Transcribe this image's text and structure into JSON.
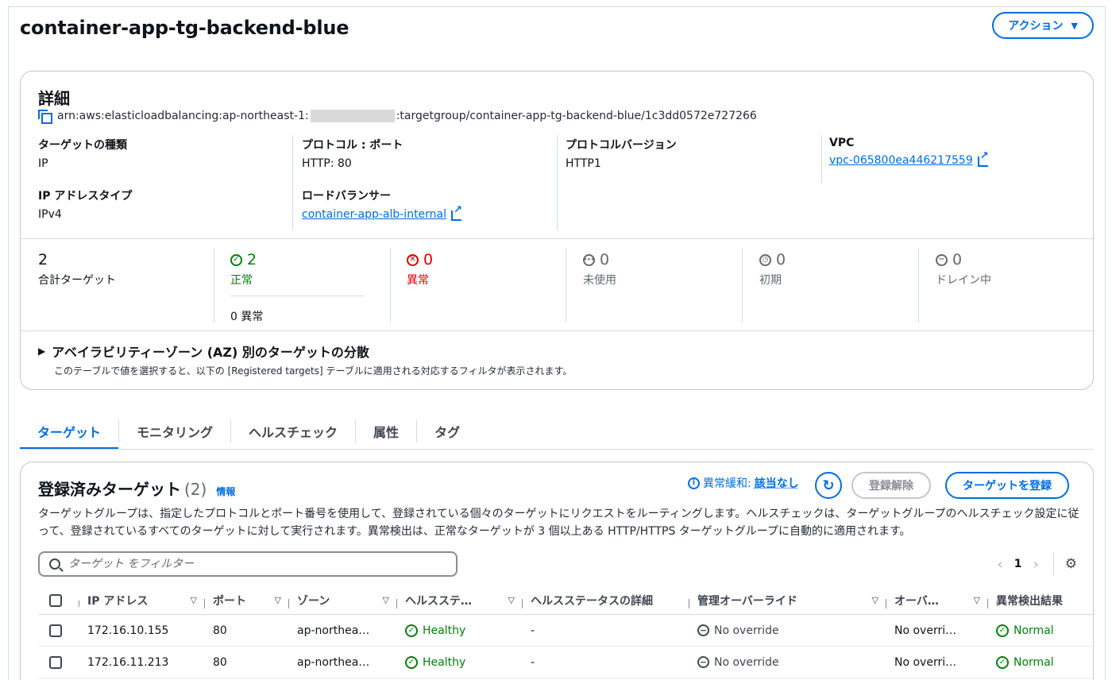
{
  "header": {
    "title": "container-app-tg-backend-blue",
    "action_label": "アクション"
  },
  "details": {
    "heading": "詳細",
    "arn_prefix": "arn:aws:elasticloadbalancing:ap-northeast-1:",
    "arn_suffix": ":targetgroup/container-app-tg-backend-blue/1c3dd0572e727266",
    "target_type": {
      "label": "ターゲットの種類",
      "value": "IP"
    },
    "protocol_port": {
      "label": "プロトコル : ポート",
      "value": "HTTP: 80"
    },
    "protocol_version": {
      "label": "プロトコルバージョン",
      "value": "HTTP1"
    },
    "vpc": {
      "label": "VPC",
      "value": "vpc-065800ea446217559"
    },
    "ip_address_type": {
      "label": "IP アドレスタイプ",
      "value": "IPv4"
    },
    "load_balancer": {
      "label": "ロードバランサー",
      "value": "container-app-alb-internal"
    }
  },
  "stats": {
    "total": {
      "value": "2",
      "label": "合計ターゲット"
    },
    "healthy": {
      "value": "2",
      "label": "正常",
      "sub": "0 異常"
    },
    "unhealthy": {
      "value": "0",
      "label": "異常"
    },
    "unused": {
      "value": "0",
      "label": "未使用"
    },
    "initial": {
      "value": "0",
      "label": "初期"
    },
    "draining": {
      "value": "0",
      "label": "ドレイン中"
    }
  },
  "az": {
    "heading": "アベイラビリティーゾーン (AZ) 別のターゲットの分散",
    "description": "このテーブルで値を選択すると、以下の [Registered targets] テーブルに適用される対応するフィルタが表示されます。"
  },
  "tabs": [
    "ターゲット",
    "モニタリング",
    "ヘルスチェック",
    "属性",
    "タグ"
  ],
  "targets": {
    "heading": "登録済みターゲット",
    "count": "(2)",
    "info": "情報",
    "anomaly_label": "異常緩和:",
    "anomaly_value": "該当なし",
    "deregister_label": "登録解除",
    "register_label": "ターゲットを登録",
    "description": "ターゲットグループは、指定したプロトコルとポート番号を使用して、登録されている個々のターゲットにリクエストをルーティングします。ヘルスチェックは、ターゲットグループのヘルスチェック設定に従って、登録されているすべてのターゲットに対して実行されます。異常検出は、正常なターゲットが 3 個以上ある HTTP/HTTPS ターゲットグループに自動的に適用されます。",
    "filter_placeholder": "ターゲット をフィルター",
    "page": "1",
    "columns": [
      "IP アドレス",
      "ポート",
      "ゾーン",
      "ヘルスステ…",
      "ヘルスステータスの詳細",
      "管理オーバーライド",
      "オーバ…",
      "異常検出結果"
    ],
    "rows": [
      {
        "ip": "172.16.10.155",
        "port": "80",
        "zone": "ap-northea…",
        "health": "Healthy",
        "detail": "-",
        "override": "No override",
        "override2": "No overri…",
        "anomaly": "Normal"
      },
      {
        "ip": "172.16.11.213",
        "port": "80",
        "zone": "ap-northea…",
        "health": "Healthy",
        "detail": "-",
        "override": "No override",
        "override2": "No overri…",
        "anomaly": "Normal"
      }
    ]
  },
  "colors": {
    "accent": "#006ce0",
    "success": "#037f0c",
    "error": "#db0000"
  }
}
